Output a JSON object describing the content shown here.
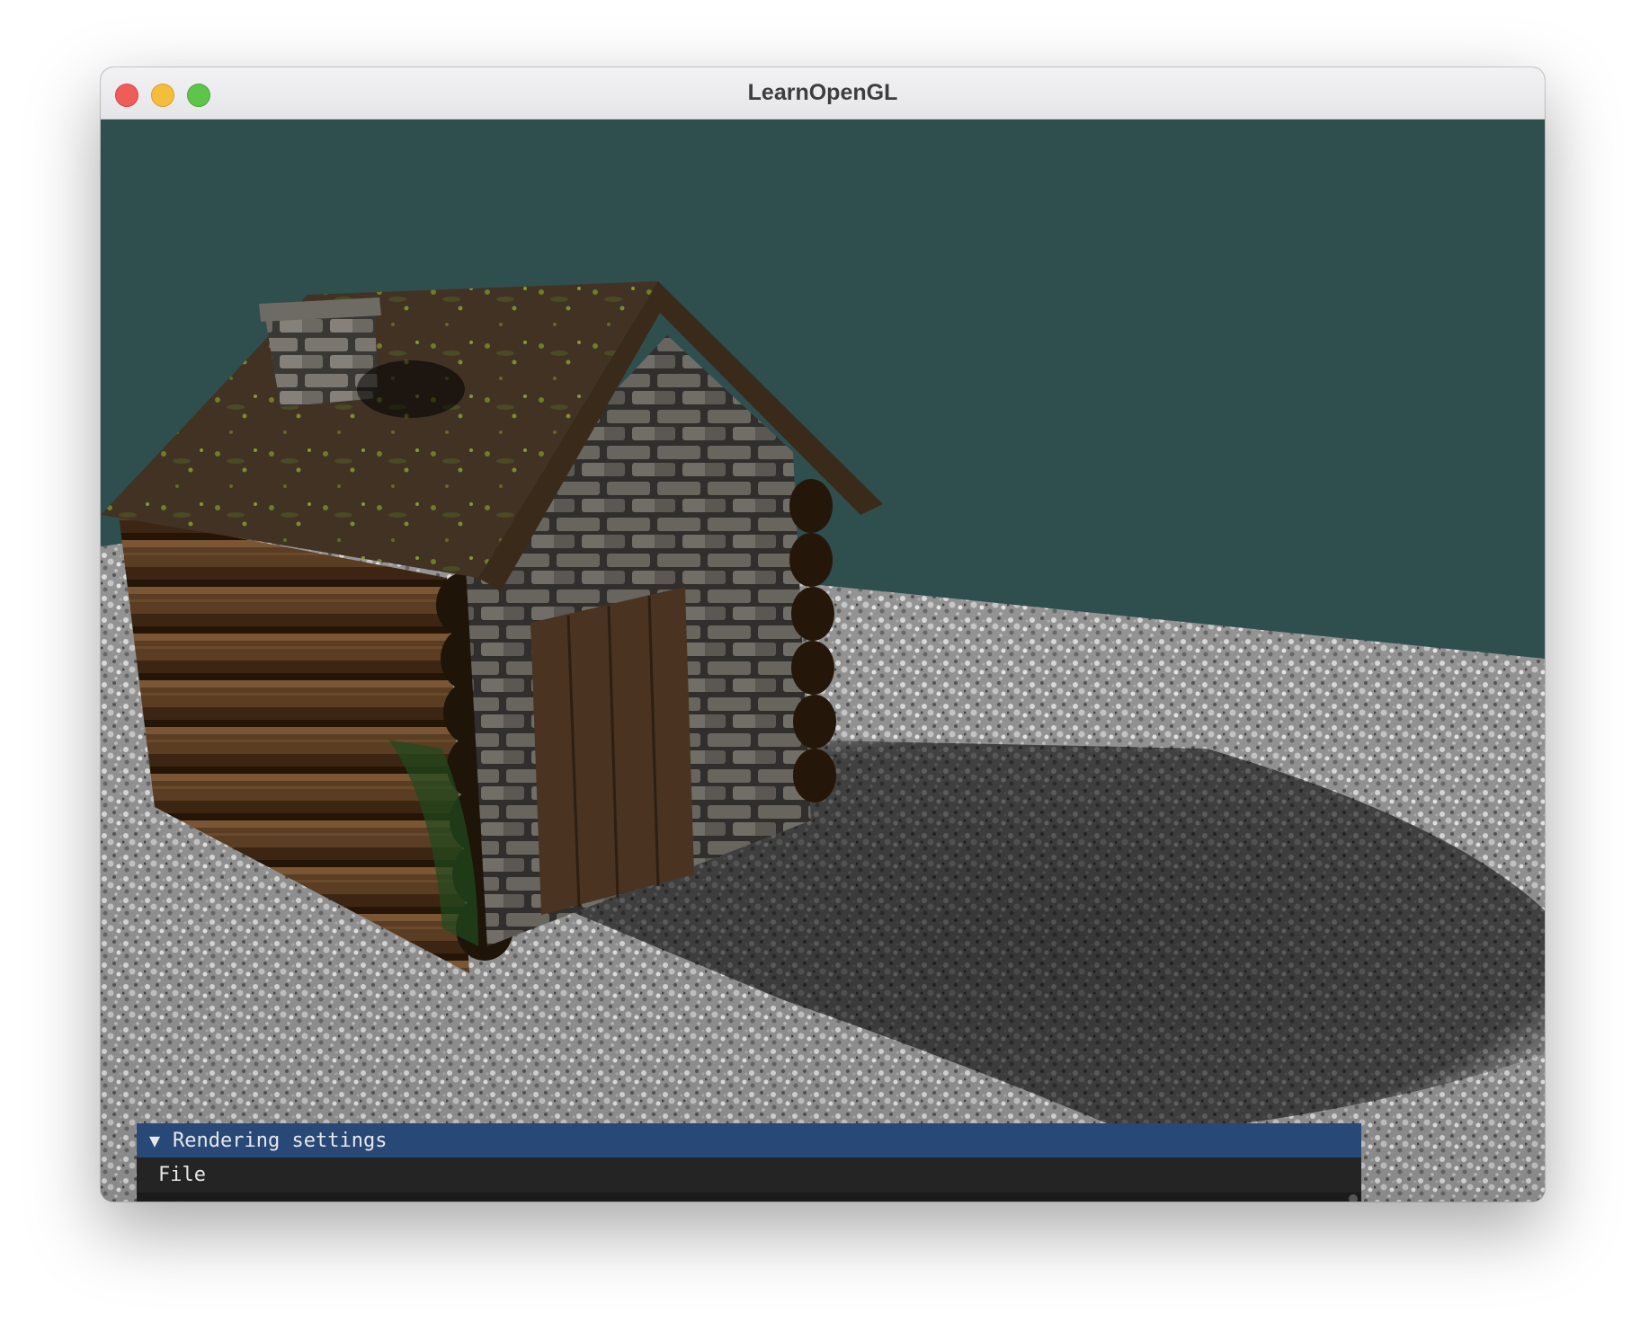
{
  "window": {
    "title": "LearnOpenGL",
    "controls": [
      "close",
      "minimize",
      "maximize"
    ]
  },
  "scene": {
    "description_icon": "cabin-scene",
    "clear_color": "#2f4e4e"
  },
  "imgui": {
    "panel_title": "Rendering settings",
    "collapse_arrow": "▼",
    "menu": [
      "File"
    ]
  }
}
